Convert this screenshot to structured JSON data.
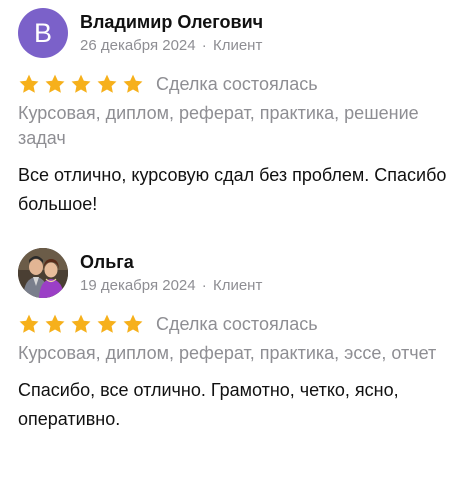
{
  "reviews": [
    {
      "author": "Владимир Олегович",
      "avatar_letter": "В",
      "avatar_color": "#7b61c9",
      "date": "26 декабря 2024",
      "separator": "·",
      "role": "Клиент",
      "rating": 5,
      "status": "Сделка состоялась",
      "categories": "Курсовая, диплом, реферат, практика, решение задач",
      "comment": "Все отлично, курсовую сдал без проблем. Спасибо большое!"
    },
    {
      "author": "Ольга",
      "avatar_type": "photo",
      "date": "19 декабря 2024",
      "separator": "·",
      "role": "Клиент",
      "rating": 5,
      "status": "Сделка состоялась",
      "categories": "Курсовая, диплом, реферат, практика, эссе, отчет",
      "comment": "Спасибо, все отлично. Грамотно, четко, ясно, оперативно."
    }
  ],
  "colors": {
    "star": "#f6b01b",
    "secondary_text": "#8e8e93",
    "primary_text": "#111111"
  }
}
